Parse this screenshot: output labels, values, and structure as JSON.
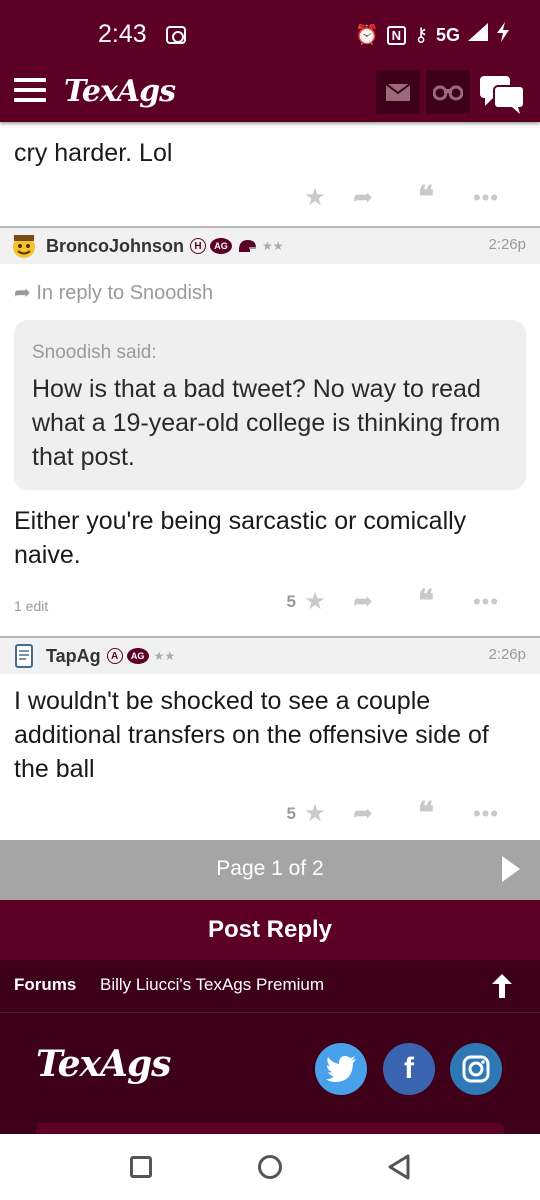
{
  "status": {
    "time": "2:43",
    "network": "5G"
  },
  "app": {
    "logo": "TexAgs"
  },
  "posts": [
    {
      "body": "cry harder. Lol"
    },
    {
      "username": "BroncoJohnson",
      "badge_letter": "H",
      "badge_ag": "AG",
      "stars": "★★",
      "time": "2:26p",
      "in_reply": "In reply to Snoodish",
      "quote_author": "Snoodish said:",
      "quote_text": "How is that a bad tweet? No way to read what a 19-year-old college is thinking from that post.",
      "body": "Either you're being sarcastic or comically naive.",
      "edit": "1 edit",
      "star_count": "5"
    },
    {
      "username": "TapAg",
      "badge_letter": "A",
      "badge_ag": "AG",
      "stars": "★★",
      "time": "2:26p",
      "body": "I wouldn't be shocked to see a couple additional transfers on the offensive side of the ball",
      "star_count": "5"
    }
  ],
  "pager": {
    "label": "Page 1 of 2"
  },
  "post_reply": "Post Reply",
  "breadcrumb": {
    "forums": "Forums",
    "board": "Billy Liucci's TexAgs Premium"
  },
  "footer": {
    "logo": "TexAgs",
    "facebook_glyph": "f"
  },
  "colors": {
    "maroon": "#5d0025",
    "dark_maroon": "#3e0018",
    "pager_gray": "#a5a5a5",
    "twitter": "#4aa1eb",
    "facebook": "#3b64b0",
    "instagram": "#2d78b5"
  },
  "icons": [
    "menu-icon",
    "mail-icon",
    "binoculars-icon",
    "chat-icon",
    "star-icon",
    "reply-icon",
    "quote-icon",
    "more-icon",
    "next-page-icon",
    "arrow-up-icon",
    "twitter-icon",
    "facebook-icon",
    "instagram-icon"
  ]
}
